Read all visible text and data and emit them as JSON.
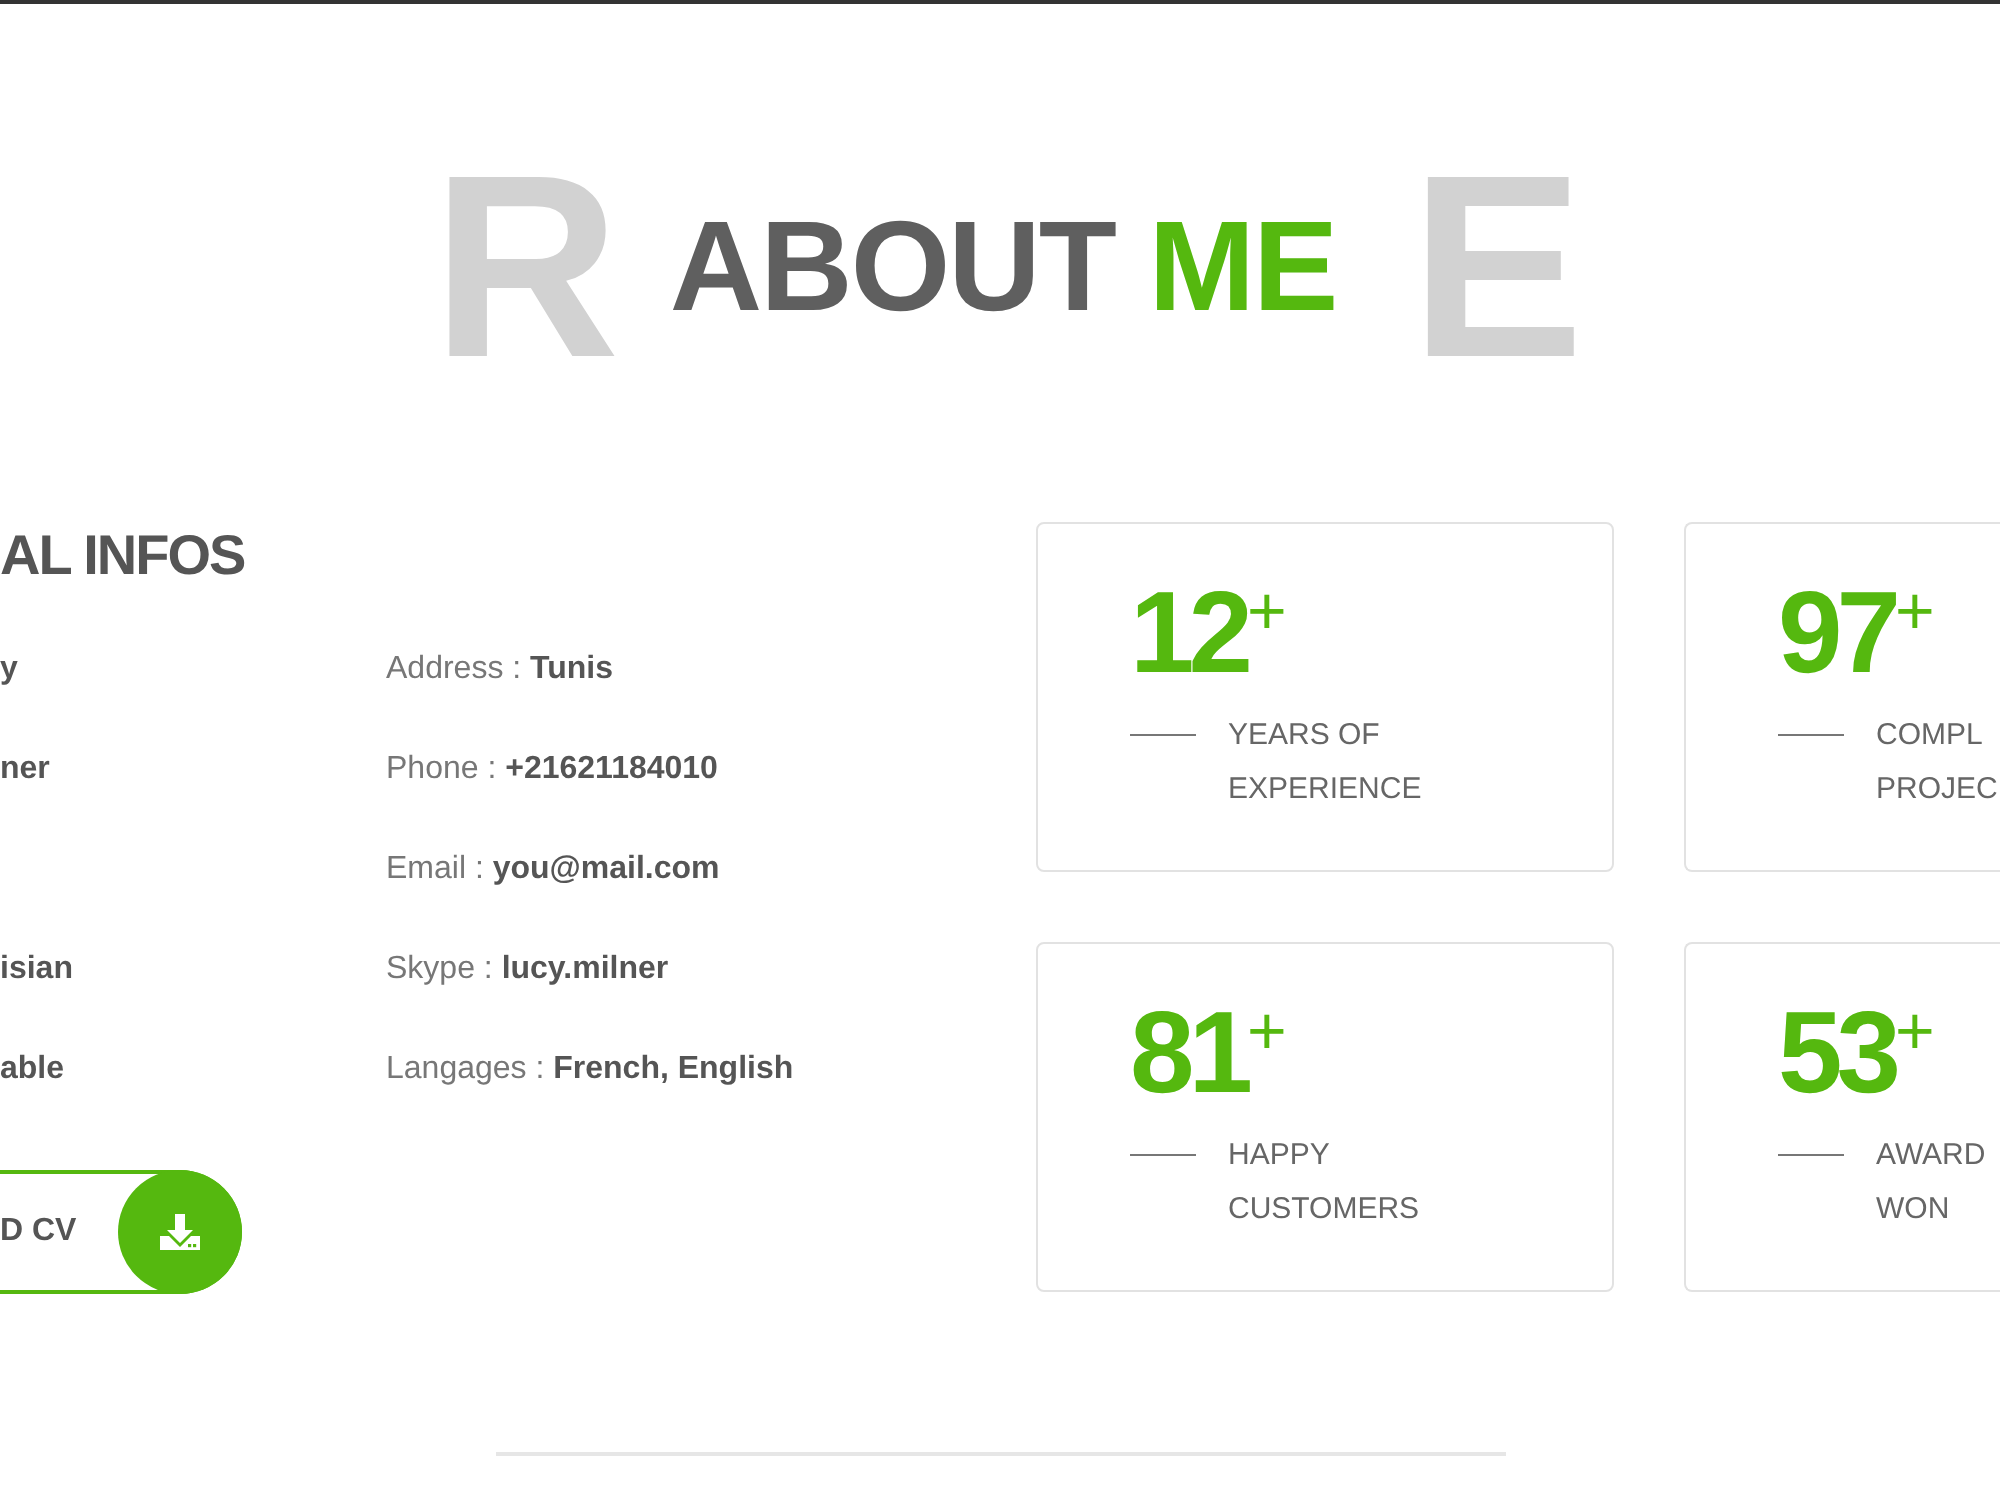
{
  "header": {
    "background_letters": [
      "R",
      "E"
    ],
    "title": [
      {
        "text": "ABOUT",
        "accent": false
      },
      {
        "text": "ME",
        "accent": true
      }
    ]
  },
  "personal_infos": {
    "heading": "AL INFOS",
    "rows": [
      {
        "left": "y",
        "right": "Address : **Tunis**"
      },
      {
        "left": "ner",
        "right": "Phone : **+21621184010**"
      },
      {
        "right": "Email : **you@mail.com**"
      },
      {
        "left": "isian",
        "right": "Skype : **lucy.milner**"
      },
      {
        "left": "able",
        "right": "Langages : **French, English**"
      }
    ],
    "download_button": {
      "label": "D CV"
    }
  },
  "stats": [
    {
      "value": "12$^{+}$",
      "label_lines": [
        "YEARS OF",
        "EXPERIENCE"
      ]
    },
    {
      "value": "97$^{+}$",
      "label_lines": [
        "COMPL",
        "PROJEC"
      ]
    },
    {
      "value": "81$^{+}$",
      "label_lines": [
        "HAPPY",
        "CUSTOMERS"
      ]
    },
    {
      "value": "53$^{+}$",
      "label_lines": [
        "AWARD",
        "WON"
      ]
    }
  ]
}
